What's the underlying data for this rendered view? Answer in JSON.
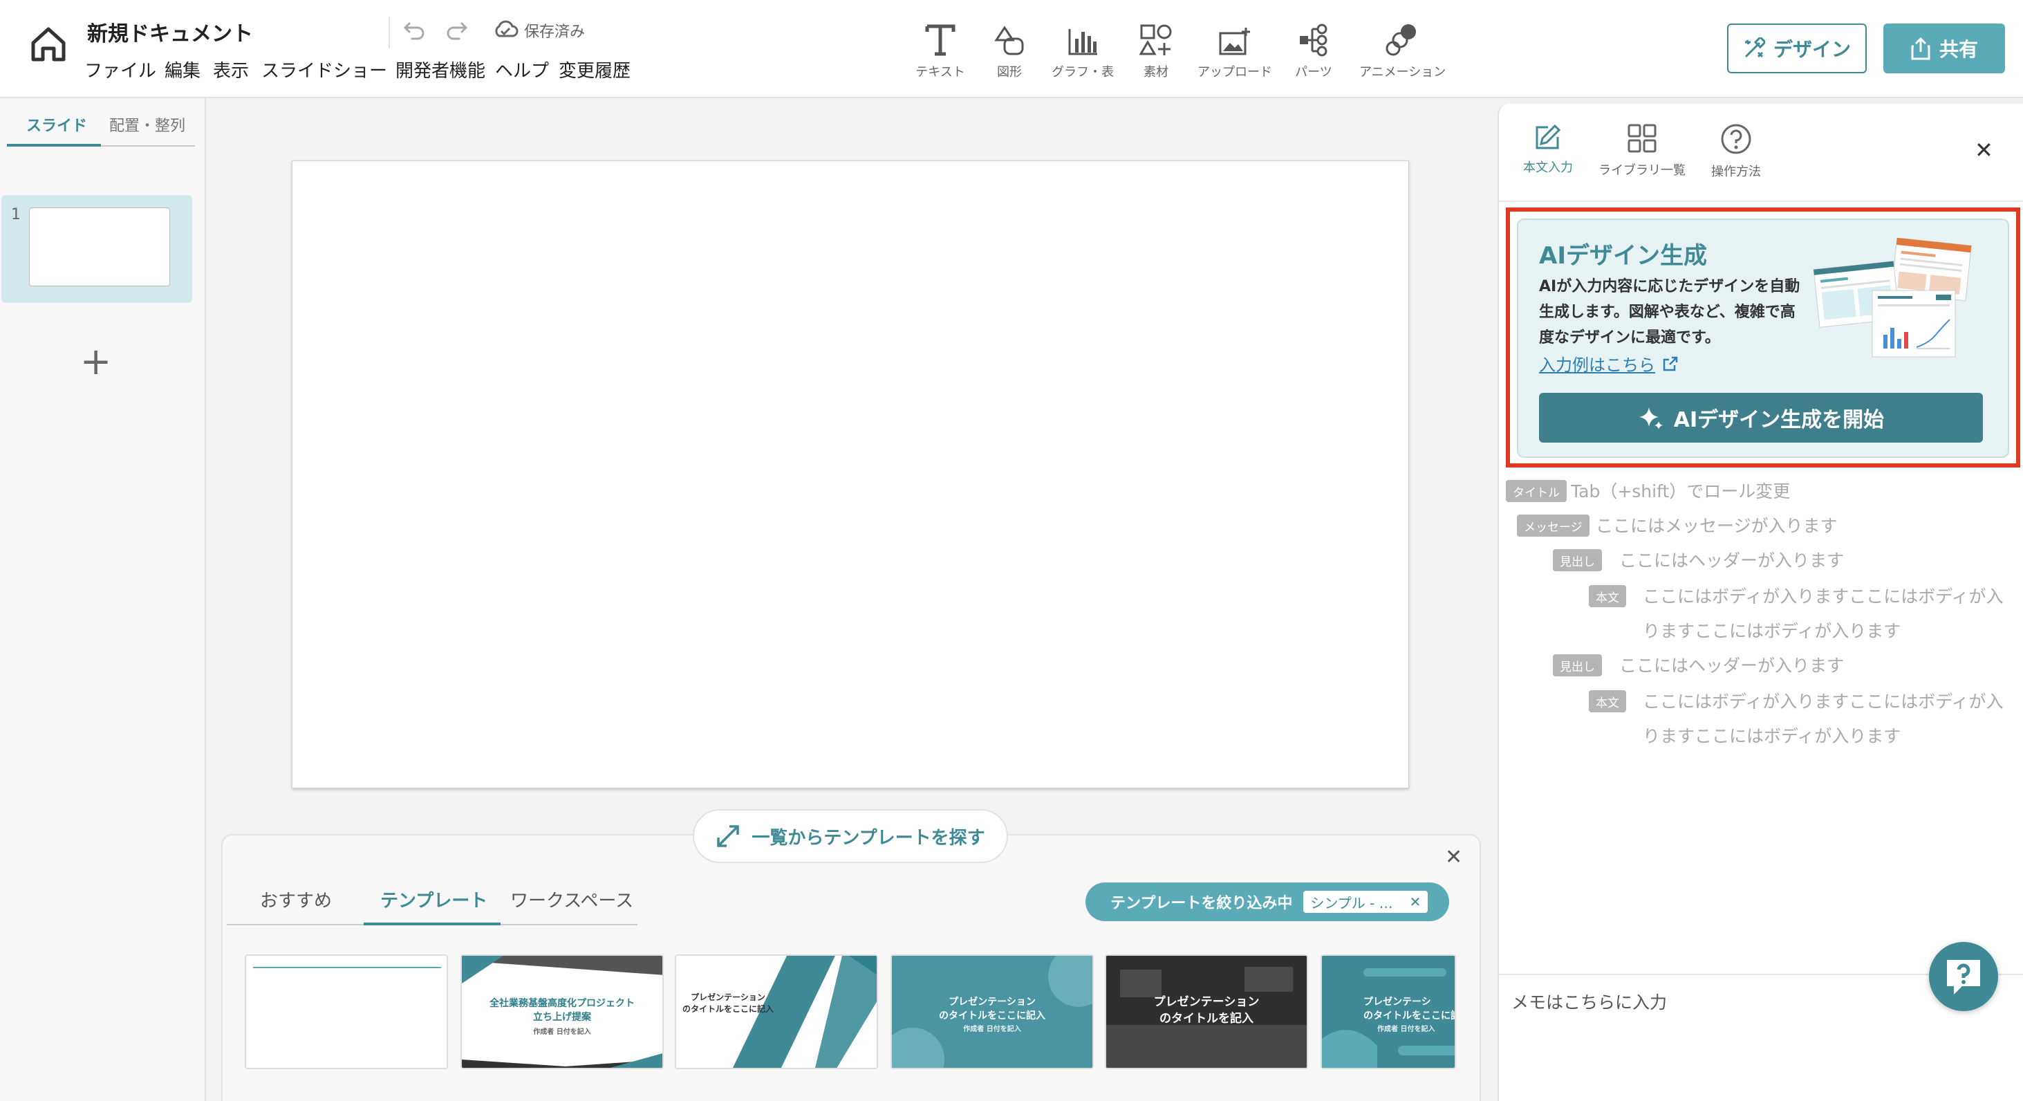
{
  "header": {
    "doc_title": "新規ドキュメント",
    "saved_status": "保存済み",
    "menu": [
      "ファイル",
      "編集",
      "表示",
      "スライドショー",
      "開発者機能",
      "ヘルプ",
      "変更履歴"
    ]
  },
  "toolbar": {
    "tools": [
      "テキスト",
      "図形",
      "グラフ・表",
      "素材",
      "アップロード",
      "パーツ",
      "アニメーション"
    ],
    "design_label": "デザイン",
    "share_label": "共有"
  },
  "sidebar": {
    "tabs": [
      "スライド",
      "配置・整列"
    ],
    "slide_number": "1",
    "add_label": "+"
  },
  "template_panel": {
    "search_label": "一覧からテンプレートを探す",
    "tabs": [
      "おすすめ",
      "テンプレート",
      "ワークスペース"
    ],
    "active_tab": "テンプレート",
    "filter_label": "テンプレートを絞り込み中",
    "filter_chip": "シンプル - …",
    "cards": [
      {
        "title": "",
        "subtitle": ""
      },
      {
        "title": "全社業務基盤高度化プロジェクト\n立ち上げ提案",
        "subtitle": "作成者 日付を記入"
      },
      {
        "title": "プレゼンテーション\nのタイトルをここに記入",
        "subtitle": ""
      },
      {
        "title": "プレゼンテーション\nのタイトルをここに記入",
        "subtitle": "作成者 日付を記入"
      },
      {
        "title": "プレゼンテーション\nのタイトルを記入",
        "subtitle": ""
      },
      {
        "title": "プレゼンテーシ\nのタイトルをここに記",
        "subtitle": "作成者 日付を記入"
      }
    ]
  },
  "right_panel": {
    "tabs": [
      "本文入力",
      "ライブラリ一覧",
      "操作方法"
    ],
    "ai_title": "AIデザイン生成",
    "ai_description": "AIが入力内容に応じたデザインを自動生成します。図解や表など、複雑で高度なデザインに最適です。",
    "ai_link": "入力例はこちら",
    "ai_start_button": "AIデザイン生成を開始",
    "outline": [
      {
        "tag": "タイトル",
        "text": "Tab（+shift）でロール変更",
        "level": 0
      },
      {
        "tag": "メッセージ",
        "text": "ここにはメッセージが入ります",
        "level": 1
      },
      {
        "tag": "見出し",
        "text": "ここにはヘッダーが入ります",
        "level": 2
      },
      {
        "tag": "本文",
        "text": "ここにはボディが入りますここにはボディが入りますここにはボディが入ります",
        "level": 3
      },
      {
        "tag": "見出し",
        "text": "ここにはヘッダーが入ります",
        "level": 2
      },
      {
        "tag": "本文",
        "text": "ここにはボディが入りますここにはボディが入りますここにはボディが入ります",
        "level": 3
      }
    ],
    "memo_placeholder": "メモはこちらに入力"
  },
  "colors": {
    "accent": "#3f8a96",
    "accent_light": "#5aaab7",
    "highlight_outline": "#e03a24"
  }
}
